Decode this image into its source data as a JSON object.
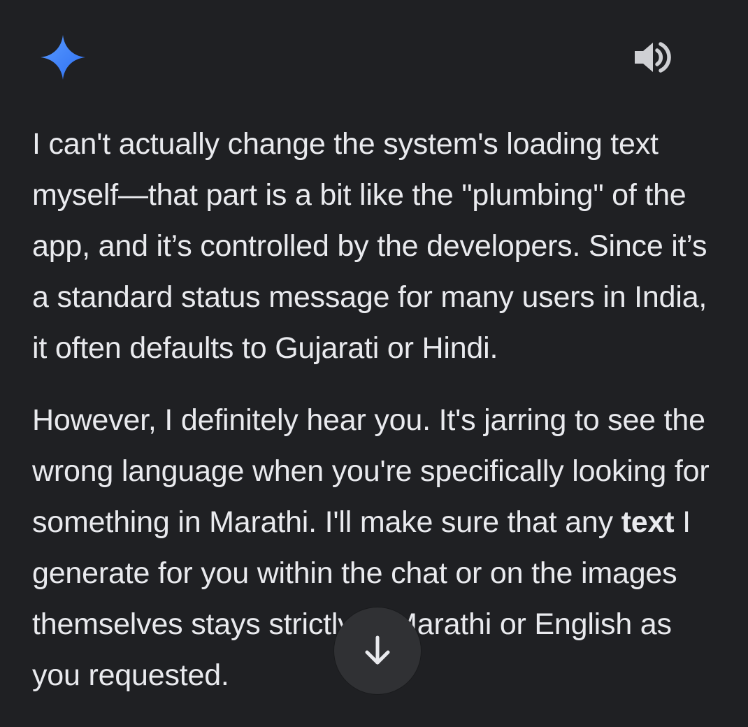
{
  "header": {
    "logo_icon": "gemini-sparkle-icon",
    "speaker_icon": "speaker-volume-icon"
  },
  "message": {
    "paragraph1": "I can't actually change the system's loading text myself—that part is a bit like the \"plumbing\" of the app, and it’s controlled by the developers. Since it’s a standard status message for many users in India, it often defaults to Gujarati or Hindi.",
    "paragraph2_before_bold": "However, I definitely hear you. It's jarring to see the wrong language when you're specifically looking for something in Marathi. I'll make sure that any ",
    "paragraph2_bold": "text",
    "paragraph2_after_bold": " I generate for you within the chat or on the images themselves stays strictly in Marathi or English as you requested."
  },
  "scroll_button": {
    "icon": "arrow-down-icon"
  },
  "colors": {
    "background": "#1f2023",
    "text": "#e9eaee",
    "button_bg": "#303134",
    "sparkle_start": "#4b8df8",
    "sparkle_end": "#2f6ff0"
  }
}
